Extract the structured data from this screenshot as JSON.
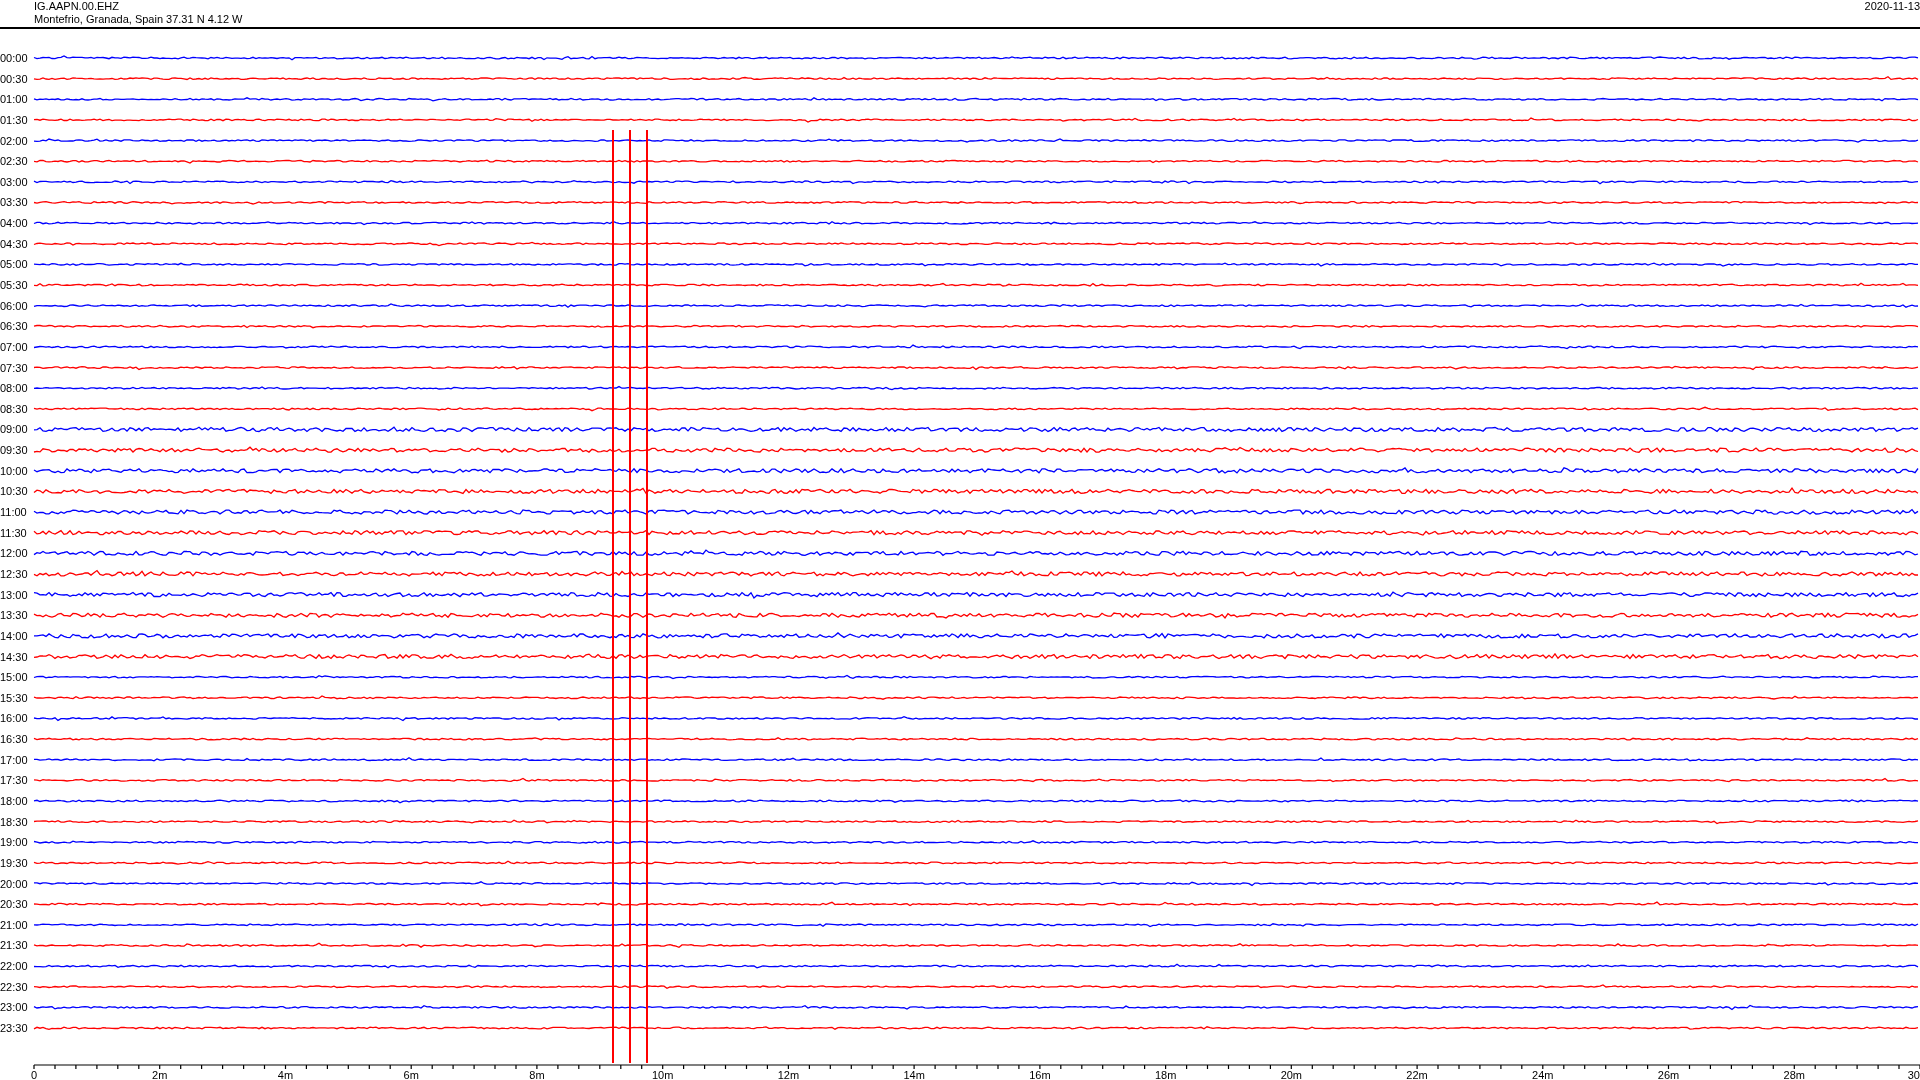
{
  "header": {
    "station": "IG.AAPN.00.EHZ",
    "location": "Montefrio, Granada, Spain  37.31 N 4.12 W",
    "date": "2020-11-13"
  },
  "traces": [
    {
      "label": "00:00",
      "color": "#0000ff"
    },
    {
      "label": "00:30",
      "color": "#ff0000"
    },
    {
      "label": "01:00",
      "color": "#0000ff"
    },
    {
      "label": "01:30",
      "color": "#ff0000"
    },
    {
      "label": "02:00",
      "color": "#0000ff"
    },
    {
      "label": "02:30",
      "color": "#ff0000"
    },
    {
      "label": "03:00",
      "color": "#0000ff"
    },
    {
      "label": "03:30",
      "color": "#ff0000"
    },
    {
      "label": "04:00",
      "color": "#0000ff"
    },
    {
      "label": "04:30",
      "color": "#ff0000"
    },
    {
      "label": "05:00",
      "color": "#0000ff"
    },
    {
      "label": "05:30",
      "color": "#ff0000"
    },
    {
      "label": "06:00",
      "color": "#0000ff"
    },
    {
      "label": "06:30",
      "color": "#ff0000"
    },
    {
      "label": "07:00",
      "color": "#0000ff"
    },
    {
      "label": "07:30",
      "color": "#ff0000"
    },
    {
      "label": "08:00",
      "color": "#0000ff"
    },
    {
      "label": "08:30",
      "color": "#ff0000"
    },
    {
      "label": "09:00",
      "color": "#0000ff"
    },
    {
      "label": "09:30",
      "color": "#ff0000"
    },
    {
      "label": "10:00",
      "color": "#0000ff"
    },
    {
      "label": "10:30",
      "color": "#ff0000"
    },
    {
      "label": "11:00",
      "color": "#0000ff"
    },
    {
      "label": "11:30",
      "color": "#ff0000"
    },
    {
      "label": "12:00",
      "color": "#0000ff"
    },
    {
      "label": "12:30",
      "color": "#ff0000"
    },
    {
      "label": "13:00",
      "color": "#0000ff"
    },
    {
      "label": "13:30",
      "color": "#ff0000"
    },
    {
      "label": "14:00",
      "color": "#0000ff"
    },
    {
      "label": "14:30",
      "color": "#ff0000"
    },
    {
      "label": "15:00",
      "color": "#0000ff"
    },
    {
      "label": "15:30",
      "color": "#ff0000"
    },
    {
      "label": "16:00",
      "color": "#0000ff"
    },
    {
      "label": "16:30",
      "color": "#ff0000"
    },
    {
      "label": "17:00",
      "color": "#0000ff"
    },
    {
      "label": "17:30",
      "color": "#ff0000"
    },
    {
      "label": "18:00",
      "color": "#0000ff"
    },
    {
      "label": "18:30",
      "color": "#ff0000"
    },
    {
      "label": "19:00",
      "color": "#0000ff"
    },
    {
      "label": "19:30",
      "color": "#ff0000"
    },
    {
      "label": "20:00",
      "color": "#0000ff"
    },
    {
      "label": "20:30",
      "color": "#ff0000"
    },
    {
      "label": "21:00",
      "color": "#0000ff"
    },
    {
      "label": "21:30",
      "color": "#ff0000"
    },
    {
      "label": "22:00",
      "color": "#0000ff"
    },
    {
      "label": "22:30",
      "color": "#ff0000"
    },
    {
      "label": "23:00",
      "color": "#0000ff"
    },
    {
      "label": "23:30",
      "color": "#ff0000"
    }
  ],
  "x_ticks": [
    "0",
    "2m",
    "4m",
    "6m",
    "8m",
    "10m",
    "12m",
    "14m",
    "16m",
    "18m",
    "20m",
    "22m",
    "24m",
    "26m",
    "28m",
    "30"
  ]
}
